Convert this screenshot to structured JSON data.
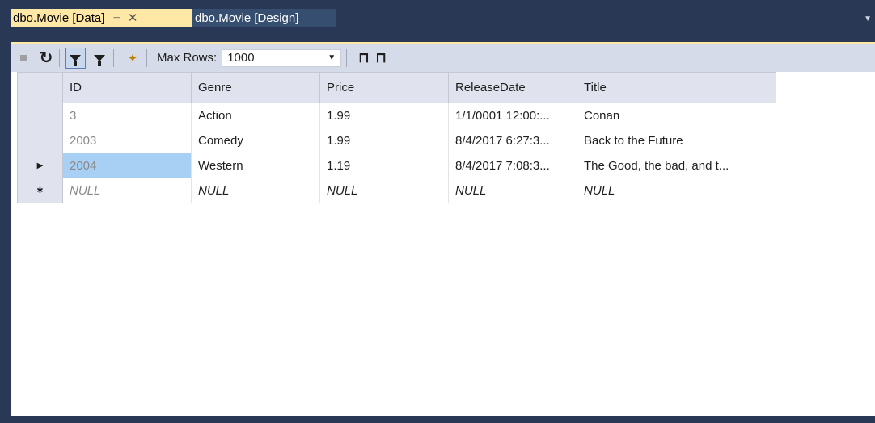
{
  "tabs": [
    {
      "label": "dbo.Movie [Data]",
      "active": true
    },
    {
      "label": "dbo.Movie [Design]",
      "active": false
    }
  ],
  "toolbar": {
    "max_rows_label": "Max Rows:",
    "max_rows_value": "1000"
  },
  "grid": {
    "columns": [
      "ID",
      "Genre",
      "Price",
      "ReleaseDate",
      "Title"
    ],
    "rows": [
      {
        "id": "3",
        "genre": "Action",
        "price": "1.99",
        "release": "1/1/0001 12:00:...",
        "title": "Conan"
      },
      {
        "id": "2003",
        "genre": "Comedy",
        "price": "1.99",
        "release": "8/4/2017 6:27:3...",
        "title": "Back to the Future"
      },
      {
        "id": "2004",
        "genre": "Western",
        "price": "1.19",
        "release": "8/4/2017 7:08:3...",
        "title": "The Good, the bad, and t..."
      }
    ],
    "new_row": {
      "id": "NULL",
      "genre": "NULL",
      "price": "NULL",
      "release": "NULL",
      "title": "NULL"
    }
  },
  "colors": {
    "chrome": "#293955",
    "active_tab": "#ffe8a6",
    "toolbar": "#d6dbe9",
    "selection": "#a8d0f5"
  }
}
